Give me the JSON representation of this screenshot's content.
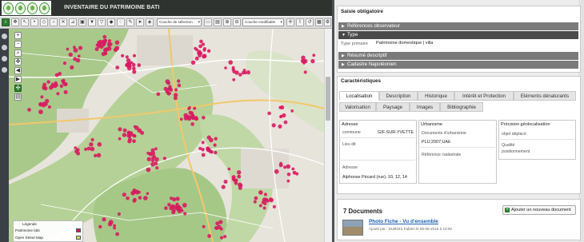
{
  "header": {
    "title": "INVENTAIRE DU PATRIMOINE BATI",
    "logo_icons": [
      "logo-1",
      "logo-2",
      "logo-3",
      "logo-4"
    ]
  },
  "toolbar": {
    "layer_select": "Couche de sélection",
    "edit_layer_select": "Couche modifiable",
    "info_glyph": "i"
  },
  "map": {
    "legend_title": "Légende",
    "legend_items": [
      {
        "label": "Patrimoine bâti",
        "color": "#d81b60"
      },
      {
        "label": "Open Street Map",
        "color": "#c8d86a"
      }
    ],
    "marker_color": "#d81b60"
  },
  "panel": {
    "mandatory_title": "Saisie obligatoire",
    "accordions": [
      {
        "label": "Références observateur",
        "open": false
      },
      {
        "label": "Type",
        "open": true
      },
      {
        "label": "Résumé descriptif",
        "open": false
      },
      {
        "label": "Cadastre Napoléonien",
        "open": false
      }
    ],
    "type_field_label": "Type primaire",
    "type_field_value": "Patrimoine domestique | villa",
    "characteristics_title": "Caractéristiques",
    "tabs_row1": [
      "Localisation",
      "Description",
      "Historique",
      "Intérêt et Protection",
      "Eléments dénaturants"
    ],
    "tabs_row2": [
      "Valorisation",
      "Paysage",
      "Images",
      "Bibliographie"
    ],
    "active_tab": "Localisation",
    "address": {
      "heading": "Adresse",
      "commune_label": "commune",
      "commune_value": "GIF-SUR-YVETTE",
      "lieu_dit_label": "Lieu dit",
      "adresse_label": "Adresse",
      "adresse_value": "Alphonse Pécard (rue), 10, 12, 14"
    },
    "urbanisme": {
      "heading": "Urbanisme",
      "doc_label": "Documents d'urbanisme",
      "doc_value": "PLU;2007;UAb",
      "ref_label": "Référence cadastrale"
    },
    "precision": {
      "heading": "Précision géolocalisation",
      "objet_label": "objet déplacé",
      "qualite_label_1": "Qualité",
      "qualite_label_2": "positionnement"
    },
    "documents": {
      "count_label": "7 Documents",
      "add_button": "Ajouter un nouveau document",
      "first_title": "Photo Fiche - Vu d'ensemble",
      "first_meta": "Ajouté par : DUBOIS Fabien le 08-06-2016 à 10:00"
    }
  }
}
